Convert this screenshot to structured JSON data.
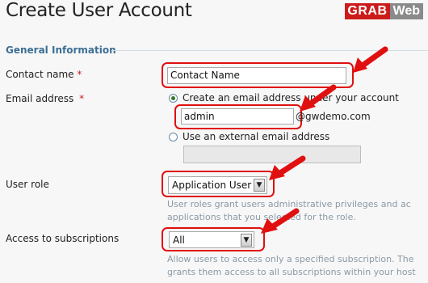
{
  "page": {
    "title": "Create User Account"
  },
  "brand": {
    "part1": "GRAB",
    "part2": "Web"
  },
  "section": {
    "heading": "General Information"
  },
  "form": {
    "contact_name": {
      "label": "Contact name",
      "required": "*",
      "value": "Contact Name"
    },
    "email": {
      "label": "Email address",
      "required": "*",
      "option_create": "Create an email address under your account",
      "username": "admin",
      "domain": "@gwdemo.com",
      "option_external": "Use an external email address",
      "external_value": ""
    },
    "user_role": {
      "label": "User role",
      "selected": "Application User",
      "help_line1": "User roles grant users administrative privileges and ac",
      "help_line2": "applications that you selected for the role."
    },
    "subscriptions": {
      "label": "Access to subscriptions",
      "selected": "All",
      "help_line1": "Allow users to access only a specified subscription. The",
      "help_line2": "grants them access to all subscriptions within your host"
    }
  },
  "colors": {
    "annotation": "#e01010",
    "section_heading": "#3d6f95",
    "brand_red": "#cc1b1b",
    "brand_gray": "#8a8a8a"
  },
  "icons": {
    "select_arrow": "chevron-down-icon",
    "annotation_arrow": "red-arrow-icon"
  }
}
